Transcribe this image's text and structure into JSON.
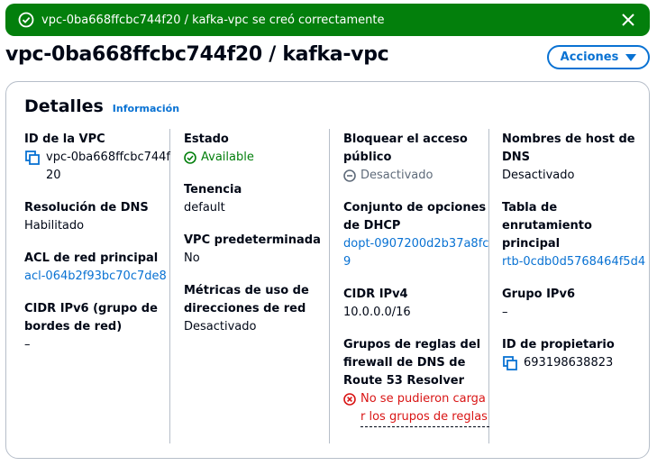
{
  "flash": {
    "message": "vpc-0ba668ffcbc744f20 / kafka-vpc se creó correctamente"
  },
  "header": {
    "title": "vpc-0ba668ffcbc744f20 / kafka-vpc",
    "actions_label": "Acciones"
  },
  "details": {
    "title": "Detalles",
    "info_link": "Información",
    "col1": {
      "vpc_id_label": "ID de la VPC",
      "vpc_id_value": "vpc-0ba668ffcbc744f20",
      "dns_resolution_label": "Resolución de DNS",
      "dns_resolution_value": "Habilitado",
      "acl_label": "ACL de red principal",
      "acl_value": "acl-064b2f93bc70c7de8",
      "ipv6_cidr_label": "CIDR IPv6 (grupo de bordes de red)",
      "ipv6_cidr_value": "–"
    },
    "col2": {
      "state_label": "Estado",
      "state_value": "Available",
      "tenancy_label": "Tenencia",
      "tenancy_value": "default",
      "default_vpc_label": "VPC predeterminada",
      "default_vpc_value": "No",
      "metrics_label": "Métricas de uso de direcciones de red",
      "metrics_value": "Desactivado"
    },
    "col3": {
      "block_label": "Bloquear el acceso público",
      "block_value": "Desactivado",
      "dhcp_label": "Conjunto de opciones de DHCP",
      "dhcp_value": "dopt-0907200d2b37a8fc9",
      "ipv4_label": "CIDR IPv4",
      "ipv4_value": "10.0.0.0/16",
      "route53_label": "Grupos de reglas del firewall de DNS de Route 53 Resolver",
      "route53_error": "No se pudieron cargar los grupos de reglas"
    },
    "col4": {
      "dns_hostnames_label": "Nombres de host de DNS",
      "dns_hostnames_value": "Desactivado",
      "route_table_label": "Tabla de enrutamiento principal",
      "route_table_value": "rtb-0cdb0d5768464f5d4",
      "ipv6_pool_label": "Grupo IPv6",
      "ipv6_pool_value": "–",
      "owner_label": "ID de propietario",
      "owner_value": "693198638823"
    }
  },
  "colors": {
    "success": "#037f0c",
    "link": "#0972d3",
    "error": "#d91515",
    "muted": "#5f6b7a"
  },
  "icons": [
    "check-circle-icon",
    "close-icon",
    "caret-down-icon",
    "copy-icon",
    "status-check-icon",
    "disabled-circle-icon",
    "error-icon"
  ]
}
